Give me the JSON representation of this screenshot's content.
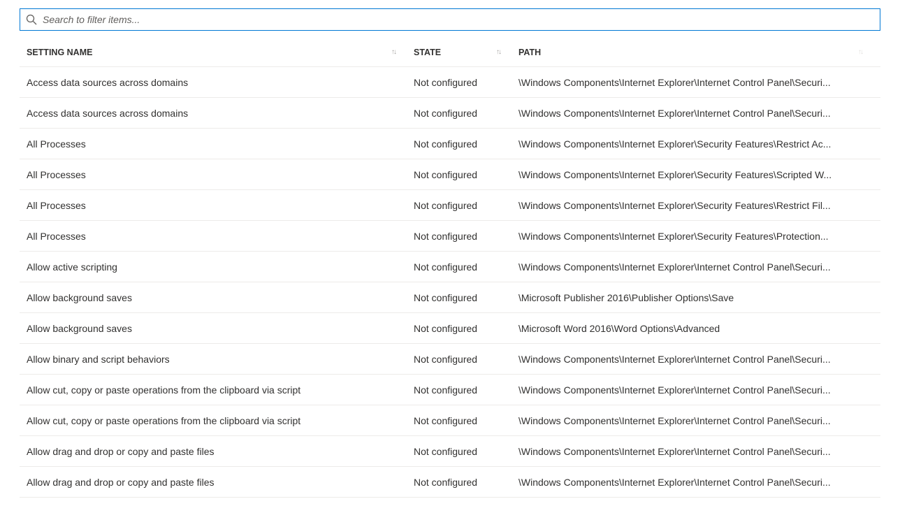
{
  "search": {
    "placeholder": "Search to filter items..."
  },
  "columns": {
    "name": "SETTING NAME",
    "state": "STATE",
    "path": "PATH"
  },
  "rows": [
    {
      "name": "Access data sources across domains",
      "state": "Not configured",
      "path": "\\Windows Components\\Internet Explorer\\Internet Control Panel\\Securi..."
    },
    {
      "name": "Access data sources across domains",
      "state": "Not configured",
      "path": "\\Windows Components\\Internet Explorer\\Internet Control Panel\\Securi..."
    },
    {
      "name": "All Processes",
      "state": "Not configured",
      "path": "\\Windows Components\\Internet Explorer\\Security Features\\Restrict Ac..."
    },
    {
      "name": "All Processes",
      "state": "Not configured",
      "path": "\\Windows Components\\Internet Explorer\\Security Features\\Scripted W..."
    },
    {
      "name": "All Processes",
      "state": "Not configured",
      "path": "\\Windows Components\\Internet Explorer\\Security Features\\Restrict Fil..."
    },
    {
      "name": "All Processes",
      "state": "Not configured",
      "path": "\\Windows Components\\Internet Explorer\\Security Features\\Protection..."
    },
    {
      "name": "Allow active scripting",
      "state": "Not configured",
      "path": "\\Windows Components\\Internet Explorer\\Internet Control Panel\\Securi..."
    },
    {
      "name": "Allow background saves",
      "state": "Not configured",
      "path": "\\Microsoft Publisher 2016\\Publisher Options\\Save"
    },
    {
      "name": "Allow background saves",
      "state": "Not configured",
      "path": "\\Microsoft Word 2016\\Word Options\\Advanced"
    },
    {
      "name": "Allow binary and script behaviors",
      "state": "Not configured",
      "path": "\\Windows Components\\Internet Explorer\\Internet Control Panel\\Securi..."
    },
    {
      "name": "Allow cut, copy or paste operations from the clipboard via script",
      "state": "Not configured",
      "path": "\\Windows Components\\Internet Explorer\\Internet Control Panel\\Securi..."
    },
    {
      "name": "Allow cut, copy or paste operations from the clipboard via script",
      "state": "Not configured",
      "path": "\\Windows Components\\Internet Explorer\\Internet Control Panel\\Securi..."
    },
    {
      "name": "Allow drag and drop or copy and paste files",
      "state": "Not configured",
      "path": "\\Windows Components\\Internet Explorer\\Internet Control Panel\\Securi..."
    },
    {
      "name": "Allow drag and drop or copy and paste files",
      "state": "Not configured",
      "path": "\\Windows Components\\Internet Explorer\\Internet Control Panel\\Securi..."
    }
  ]
}
